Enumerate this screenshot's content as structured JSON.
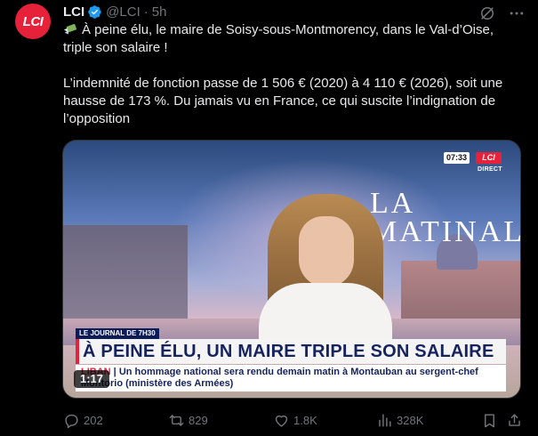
{
  "post": {
    "author_name": "LCI",
    "avatar_text": "LCI",
    "handle": "@LCI",
    "separator": "·",
    "time": "5h",
    "line1": "À peine élu, le maire de Soisy-sous-Montmorency, dans le Val-d’Oise, triple son salaire !",
    "line2": "L’indemnité de fonction passe de 1 506 € (2020) à 4 110 € (2026), soit une hausse de 173 %. Du jamais vu en France, ce qui suscite l’indignation de l’opposition"
  },
  "video": {
    "clock": "07:33",
    "channel_logo": "LCI",
    "live_label": "DIRECT",
    "show_title_line1": "LA",
    "show_title_line2": "MATINALE",
    "journal_label": "LE JOURNAL DE 7H30",
    "headline": "À PEINE ÉLU, UN MAIRE TRIPLE SON SALAIRE",
    "ticker_tag": "LIBAN",
    "ticker_text": "Un hommage national sera rendu demain matin à Montauban au sergent-chef Montorio (ministère des Armées)",
    "duration": "1:17"
  },
  "actions": {
    "replies": "202",
    "reposts": "829",
    "likes": "1.8K",
    "views": "328K"
  },
  "colors": {
    "background": "#000000",
    "text": "#e7e9ea",
    "muted": "#71767b",
    "verified": "#1d9bf0",
    "brand_red": "#e8213a"
  },
  "icons": [
    "verified-icon",
    "grok-icon",
    "more-icon",
    "money-wings-emoji",
    "reply-icon",
    "repost-icon",
    "like-icon",
    "views-icon",
    "bookmark-icon",
    "share-icon"
  ]
}
